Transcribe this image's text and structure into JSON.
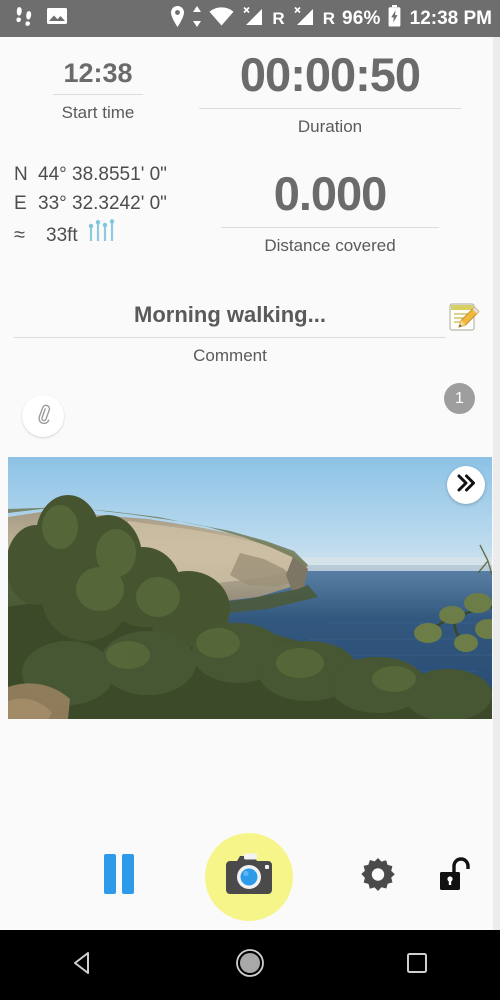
{
  "statusbar": {
    "left_icons": [
      "footsteps-icon",
      "photo-icon"
    ],
    "right_icons": [
      "location-pin-icon",
      "data-transfer-icon",
      "wifi-icon",
      "cell-signal-icon",
      "cell-signal-icon"
    ],
    "roaming_1": "R",
    "roaming_2": "R",
    "battery_percent": "96%",
    "battery_icon": "battery-charging-icon",
    "clock": "12:38 PM",
    "background_color": "#6e6e6e"
  },
  "stats": {
    "start_time": {
      "value": "12:38",
      "label": "Start time"
    },
    "duration": {
      "value": "00:00:50",
      "label": "Duration"
    },
    "distance": {
      "value": "0.000",
      "label": "Distance covered"
    }
  },
  "location": {
    "lat_axis": "N",
    "lat_value": "44° 38.8551' 0\"",
    "lon_axis": "E",
    "lon_value": "33° 32.3242' 0\"",
    "altitude_prefix": "≈",
    "altitude": "33ft",
    "gps_signal_icon": "satellite-signal-icon",
    "gps_signal_color": "#7fc4dd"
  },
  "comment": {
    "text": "Morning walking...",
    "label": "Comment",
    "edit_icon": "note-edit-icon"
  },
  "attachments": {
    "clip_icon": "paperclip-icon",
    "count": "1"
  },
  "photo": {
    "alt": "coastal cliffs and sea landscape photo",
    "next_icon": "double-chevron-right-icon"
  },
  "toolbar": {
    "pause_label": "pause-icon",
    "pause_color": "#2e9bea",
    "camera_label": "camera-icon",
    "camera_bg": "#f6f58a",
    "camera_lens_color": "#2e9bea",
    "settings_label": "gear-icon",
    "lock_label": "unlocked-padlock-icon"
  },
  "navbar": {
    "back_label": "back-icon",
    "home_label": "home-icon",
    "recents_label": "recents-icon"
  }
}
